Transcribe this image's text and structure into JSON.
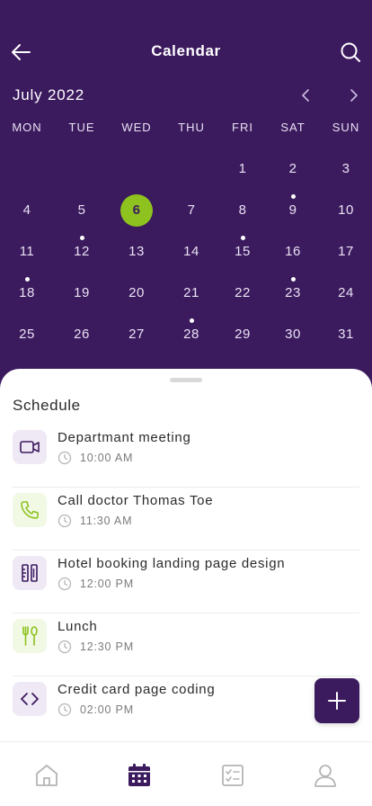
{
  "header": {
    "title": "Calendar",
    "back_icon": "arrow-left-icon",
    "search_icon": "search-icon"
  },
  "calendar": {
    "month_label": "July 2022",
    "prev_icon": "chevron-left-icon",
    "next_icon": "chevron-right-icon",
    "weekdays": [
      "MON",
      "TUE",
      "WED",
      "THU",
      "FRI",
      "SAT",
      "SUN"
    ],
    "selected_day": "6",
    "rows": [
      [
        "",
        "",
        "",
        "",
        "1",
        "2",
        "3"
      ],
      [
        "4",
        "5",
        "6",
        "7",
        "8",
        "9",
        "10"
      ],
      [
        "11",
        "12",
        "13",
        "14",
        "15",
        "16",
        "17"
      ],
      [
        "18",
        "19",
        "20",
        "21",
        "22",
        "23",
        "24"
      ],
      [
        "25",
        "26",
        "27",
        "28",
        "29",
        "30",
        "31"
      ]
    ],
    "days_with_events": [
      "9",
      "12",
      "15",
      "18",
      "23",
      "28"
    ]
  },
  "schedule": {
    "title": "Schedule",
    "events": [
      {
        "title": "Departmant meeting",
        "time": "10:00 AM",
        "icon": "video-camera-icon",
        "tone": "purple"
      },
      {
        "title": "Call doctor Thomas Toe",
        "time": "11:30 AM",
        "icon": "phone-icon",
        "tone": "green"
      },
      {
        "title": "Hotel booking landing page design",
        "time": "12:00 PM",
        "icon": "ruler-pencil-icon",
        "tone": "purple"
      },
      {
        "title": "Lunch",
        "time": "12:30 PM",
        "icon": "fork-spoon-icon",
        "tone": "green"
      },
      {
        "title": "Credit card page coding",
        "time": "02:00 PM",
        "icon": "code-icon",
        "tone": "purple"
      }
    ]
  },
  "fab": {
    "icon": "plus-icon"
  },
  "tabbar": {
    "tabs": [
      {
        "icon": "home-icon",
        "active": false
      },
      {
        "icon": "calendar-icon",
        "active": true
      },
      {
        "icon": "checklist-icon",
        "active": false
      },
      {
        "icon": "profile-icon",
        "active": false
      }
    ]
  },
  "colors": {
    "primary": "#3b1a5e",
    "accent": "#8dc21f",
    "purple_tint": "#efe9f6",
    "green_tint": "#f1f8e4",
    "muted_icon": "#b5b5b5"
  }
}
